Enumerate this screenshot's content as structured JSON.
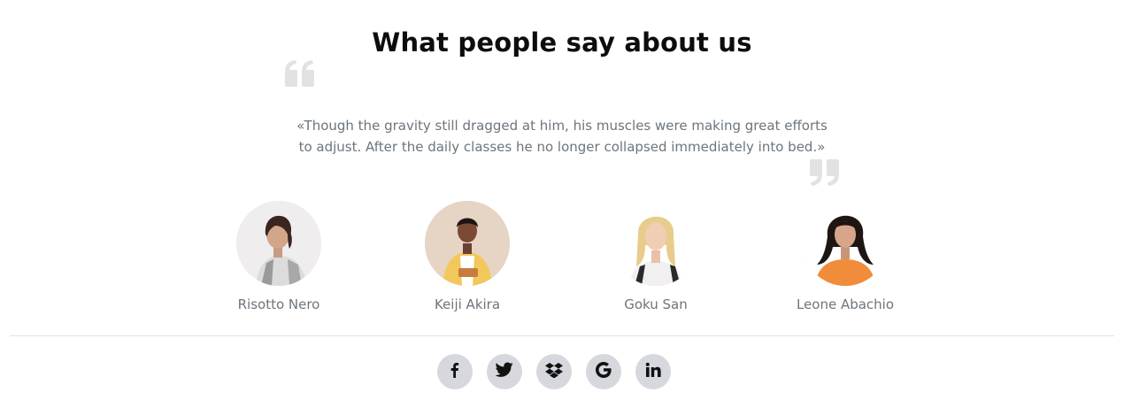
{
  "section": {
    "title": "What people say about us"
  },
  "testimonial": {
    "text": "«Though the gravity still dragged at him, his muscles were making great efforts to adjust. After the daily classes he no longer collapsed immediately into bed.»"
  },
  "people": [
    {
      "name": "Risotto Nero"
    },
    {
      "name": "Keiji Akira"
    },
    {
      "name": "Goku San"
    },
    {
      "name": "Leone Abachio"
    }
  ],
  "social": [
    {
      "icon": "facebook-icon"
    },
    {
      "icon": "twitter-icon"
    },
    {
      "icon": "dropbox-icon"
    },
    {
      "icon": "google-icon"
    },
    {
      "icon": "linkedin-icon"
    }
  ],
  "colors": {
    "quote_mark": "#e2e2e2",
    "social_bg": "#d6d8dd",
    "muted_text": "#6c757d"
  }
}
